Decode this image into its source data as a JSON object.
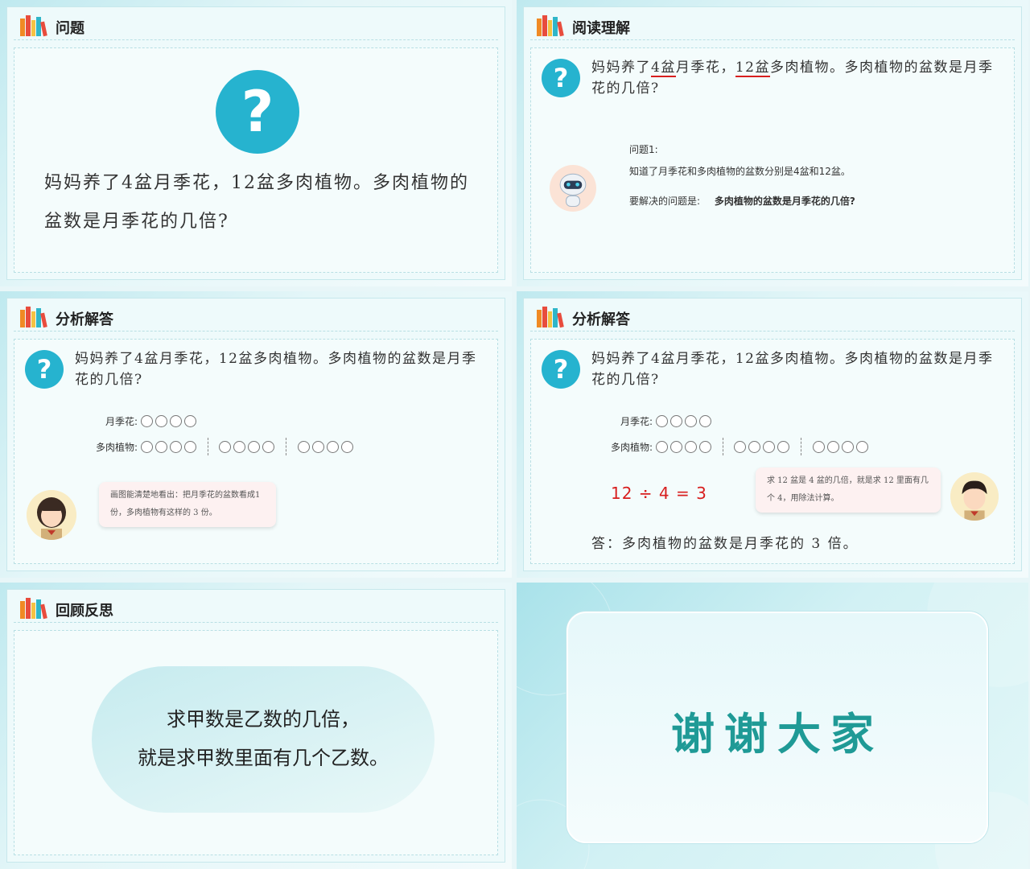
{
  "slides": {
    "s1": {
      "title": "问题",
      "qmark": "?",
      "problem": "妈妈养了4盆月季花，12盆多肉植物。多肉植物的盆数是月季花的几倍?"
    },
    "s2": {
      "title": "阅读理解",
      "qmark": "?",
      "problem_p1": "妈妈养了",
      "problem_u1": "4盆",
      "problem_p2": "月季花，",
      "problem_u2": "12盆",
      "problem_p3": "多肉植物。多肉植物的盆数是月季花的几倍?",
      "q_label": "问题1:",
      "known": "知道了月季花和多肉植物的盆数分别是4盆和12盆。",
      "solve_label": "要解决的问题是:",
      "solve_text": "多肉植物的盆数是月季花的几倍?"
    },
    "s3": {
      "title": "分析解答",
      "qmark": "?",
      "problem": "妈妈养了4盆月季花，12盆多肉植物。多肉植物的盆数是月季花的几倍?",
      "rose_label": "月季花:",
      "succulent_label": "多肉植物:",
      "bubble": "画图能清楚地看出：把月季花的盆数看成1 份，多肉植物有这样的 3 份。"
    },
    "s4": {
      "title": "分析解答",
      "qmark": "?",
      "problem": "妈妈养了4盆月季花，12盆多肉植物。多肉植物的盆数是月季花的几倍?",
      "rose_label": "月季花:",
      "succulent_label": "多肉植物:",
      "equation": "12 ÷ 4 = 3",
      "bubble": "求 12 盆是 4 盆的几倍，就是求 12 里面有几个 4，用除法计算。",
      "answer": "答：多肉植物的盆数是月季花的 3 倍。"
    },
    "s5": {
      "title": "回顾反思",
      "line1": "求甲数是乙数的几倍，",
      "line2": "就是求甲数里面有几个乙数。"
    },
    "s6": {
      "thanks": "谢谢大家"
    }
  },
  "colors": {
    "accent": "#26b3cf",
    "equation": "#d81e1e",
    "underline": "#d81e1e",
    "thanks": "#1f9a96"
  }
}
